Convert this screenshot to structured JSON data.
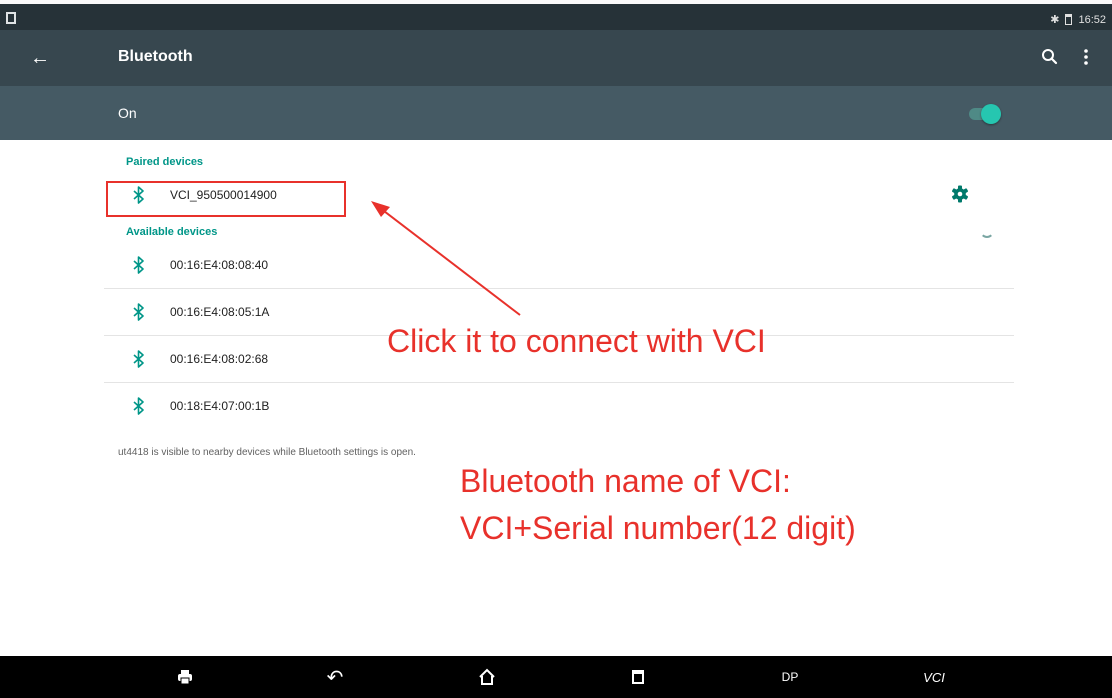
{
  "status_bar": {
    "time": "16:52",
    "bluetooth_icon": "bluetooth-icon",
    "battery_icon": "battery-icon",
    "notification_icon": "screen-icon"
  },
  "app_bar": {
    "title": "Bluetooth",
    "back_icon": "arrow-back-icon",
    "search_icon": "search-icon",
    "more_icon": "more-vert-icon"
  },
  "toggle_row": {
    "label": "On",
    "checked": true
  },
  "paired": {
    "header": "Paired devices",
    "devices": [
      {
        "name": "VCI_950500014900",
        "settings_icon": "gear-icon"
      }
    ]
  },
  "available": {
    "header": "Available devices",
    "devices": [
      {
        "name": "00:16:E4:08:08:40"
      },
      {
        "name": "00:16:E4:08:05:1A"
      },
      {
        "name": "00:16:E4:08:02:68"
      },
      {
        "name": "00:18:E4:07:00:1B"
      }
    ]
  },
  "visible_note": "ut4418 is visible to nearby devices while Bluetooth settings is open.",
  "annotations": {
    "click_hint": "Click it to connect with VCI",
    "name_hint_line1": "Bluetooth name of VCI:",
    "name_hint_line2": "VCI+Serial number(12 digit)"
  },
  "nav_bar": {
    "print_icon": "print-icon",
    "back_icon": "back-icon",
    "home_icon": "home-icon",
    "recents_icon": "recents-icon",
    "dp_label": "DP",
    "vci_label": "VCI"
  },
  "colors": {
    "status_bar": "#263238",
    "app_bar": "#37474f",
    "on_row": "#455a64",
    "accent": "#009688",
    "annotation": "#e8312b"
  }
}
